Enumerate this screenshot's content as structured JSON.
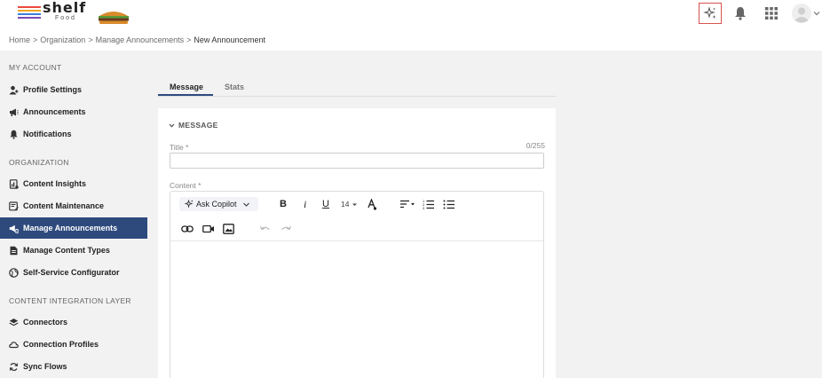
{
  "brand": {
    "logo_text": "shelf",
    "logo_sub": "Food",
    "colors": {
      "accent": "#2e4a7d",
      "copilot_border": "#d9534f"
    }
  },
  "topbar": {
    "icons": [
      "copilot-sparkle-icon",
      "bell-icon",
      "apps-grid-icon",
      "avatar-icon",
      "chevron-down-icon"
    ]
  },
  "breadcrumb": {
    "items": [
      "Home",
      "Organization",
      "Manage Announcements",
      "New Announcement"
    ],
    "separator": ">"
  },
  "sidebar": {
    "sections": [
      {
        "title": "MY ACCOUNT",
        "items": [
          {
            "label": "Profile Settings",
            "icon": "profile-icon"
          },
          {
            "label": "Announcements",
            "icon": "megaphone-icon"
          },
          {
            "label": "Notifications",
            "icon": "bell-icon"
          }
        ]
      },
      {
        "title": "ORGANIZATION",
        "items": [
          {
            "label": "Content Insights",
            "icon": "insights-icon"
          },
          {
            "label": "Content Maintenance",
            "icon": "maintenance-icon"
          },
          {
            "label": "Manage Announcements",
            "icon": "manage-announcements-icon",
            "active": true
          },
          {
            "label": "Manage Content Types",
            "icon": "content-types-icon"
          },
          {
            "label": "Self-Service Configurator",
            "icon": "globe-icon"
          }
        ]
      },
      {
        "title": "CONTENT INTEGRATION LAYER",
        "items": [
          {
            "label": "Connectors",
            "icon": "layers-icon"
          },
          {
            "label": "Connection Profiles",
            "icon": "cloud-icon"
          },
          {
            "label": "Sync Flows",
            "icon": "sync-icon"
          }
        ]
      }
    ]
  },
  "tabs": [
    {
      "label": "Message",
      "active": true
    },
    {
      "label": "Stats",
      "active": false
    }
  ],
  "form": {
    "section_title": "MESSAGE",
    "title_label": "Title *",
    "title_counter": "0/255",
    "title_value": "",
    "content_label": "Content *"
  },
  "editor": {
    "copilot_label": "Ask Copilot",
    "font_size": "14",
    "toolbar_row1": [
      "bold-icon",
      "italic-icon",
      "underline-icon",
      "font-size-select",
      "text-color-icon",
      "align-icon",
      "numbered-list-icon",
      "bullet-list-icon"
    ],
    "toolbar_row2": [
      "link-icon",
      "video-icon",
      "image-icon",
      "undo-icon",
      "redo-icon"
    ],
    "bold": "B",
    "italic": "i",
    "underline": "U"
  }
}
